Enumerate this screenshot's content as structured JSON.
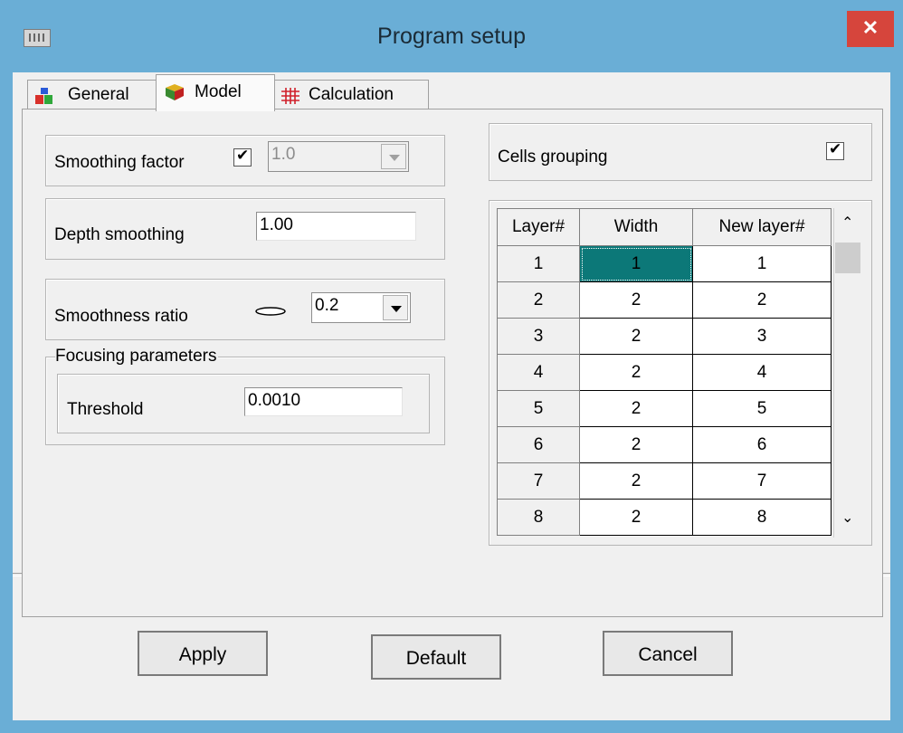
{
  "window": {
    "title": "Program setup"
  },
  "icons": {
    "app": "window-app-icon",
    "close": "close-icon",
    "general": "general-icon",
    "model": "model-icon",
    "calculation": "calculation-icon"
  },
  "tabs": [
    {
      "label": "General"
    },
    {
      "label": "Model"
    },
    {
      "label": "Calculation"
    }
  ],
  "model": {
    "smoothing_factor": {
      "label": "Smoothing factor",
      "checked": true,
      "value": "1.0"
    },
    "depth_smoothing": {
      "label": "Depth smoothing",
      "value": "1.00"
    },
    "smoothness_ratio": {
      "label": "Smoothness ratio",
      "value": "0.2"
    },
    "focusing": {
      "title": "Focusing parameters",
      "threshold_label": "Threshold",
      "threshold_value": "0.0010"
    },
    "cells_grouping": {
      "label": "Cells grouping",
      "checked": true
    }
  },
  "grid": {
    "columns": [
      "Layer#",
      "Width",
      "New layer#"
    ],
    "rows": [
      [
        "1",
        "1",
        "1"
      ],
      [
        "2",
        "2",
        "2"
      ],
      [
        "3",
        "2",
        "3"
      ],
      [
        "4",
        "2",
        "4"
      ],
      [
        "5",
        "2",
        "5"
      ],
      [
        "6",
        "2",
        "6"
      ],
      [
        "7",
        "2",
        "7"
      ],
      [
        "8",
        "2",
        "8"
      ]
    ]
  },
  "buttons": {
    "apply": "Apply",
    "default": "Default",
    "cancel": "Cancel"
  },
  "colors": {
    "titlebar": "#6aaed6",
    "close": "#d6453c",
    "selected_cell": "#0c7878"
  }
}
